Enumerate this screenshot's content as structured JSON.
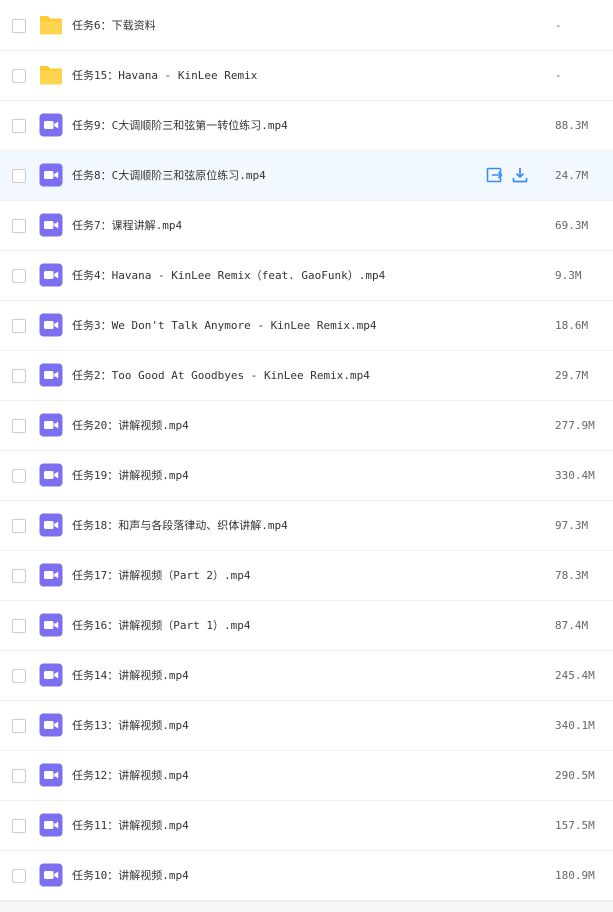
{
  "colors": {
    "folder": "#ffc933",
    "video_icon": "#7b6ff0",
    "hover_row": "#f2f8ff",
    "action_icon": "#3b8cf5"
  },
  "files": [
    {
      "name": "任务6：下载资料",
      "size": "-",
      "icon": "folder-icon"
    },
    {
      "name": "任务15：Havana - KinLee Remix",
      "size": "-",
      "icon": "folder-icon"
    },
    {
      "name": "任务9：C大调顺阶三和弦第一转位练习.mp4",
      "size": "88.3M",
      "icon": "video-icon"
    },
    {
      "name": "任务8：C大调顺阶三和弦原位练习.mp4",
      "size": "24.7M",
      "icon": "video-icon",
      "hovered": true
    },
    {
      "name": "任务7：课程讲解.mp4",
      "size": "69.3M",
      "icon": "video-icon"
    },
    {
      "name": "任务4：Havana - KinLee Remix（feat. GaoFunk）.mp4",
      "size": "9.3M",
      "icon": "video-icon"
    },
    {
      "name": "任务3：We Don't Talk Anymore - KinLee Remix.mp4",
      "size": "18.6M",
      "icon": "video-icon"
    },
    {
      "name": "任务2：Too Good At Goodbyes - KinLee Remix.mp4",
      "size": "29.7M",
      "icon": "video-icon"
    },
    {
      "name": "任务20：讲解视频.mp4",
      "size": "277.9M",
      "icon": "video-icon"
    },
    {
      "name": "任务19：讲解视频.mp4",
      "size": "330.4M",
      "icon": "video-icon"
    },
    {
      "name": "任务18：和声与各段落律动、织体讲解.mp4",
      "size": "97.3M",
      "icon": "video-icon"
    },
    {
      "name": "任务17：讲解视频（Part 2）.mp4",
      "size": "78.3M",
      "icon": "video-icon"
    },
    {
      "name": "任务16：讲解视频（Part 1）.mp4",
      "size": "87.4M",
      "icon": "video-icon"
    },
    {
      "name": "任务14：讲解视频.mp4",
      "size": "245.4M",
      "icon": "video-icon"
    },
    {
      "name": "任务13：讲解视频.mp4",
      "size": "340.1M",
      "icon": "video-icon"
    },
    {
      "name": "任务12：讲解视频.mp4",
      "size": "290.5M",
      "icon": "video-icon"
    },
    {
      "name": "任务11：讲解视频.mp4",
      "size": "157.5M",
      "icon": "video-icon"
    },
    {
      "name": "任务10：讲解视频.mp4",
      "size": "180.9M",
      "icon": "video-icon"
    }
  ],
  "row_actions": {
    "open_icon": "open-in-app-icon",
    "download_icon": "download-icon"
  }
}
